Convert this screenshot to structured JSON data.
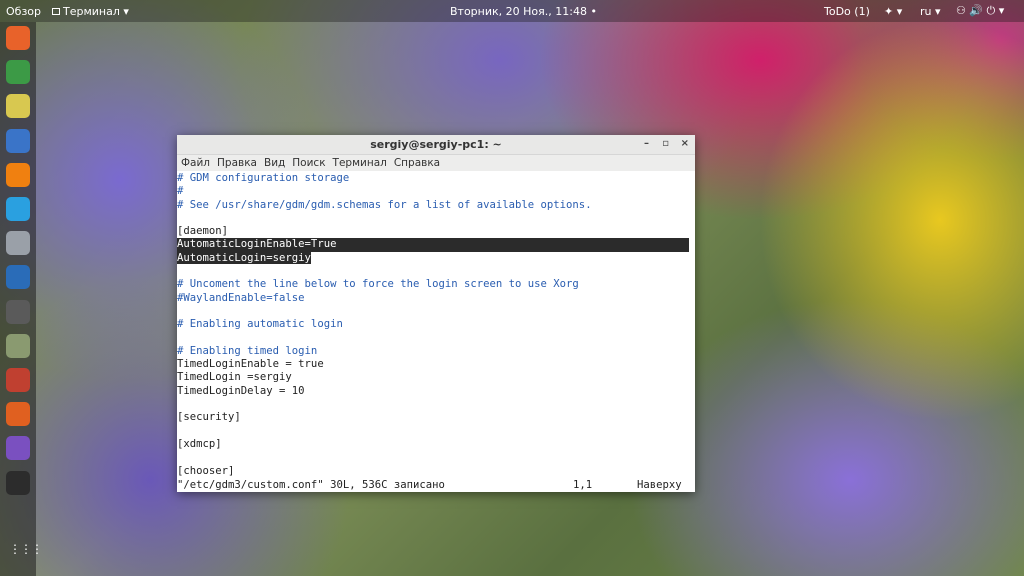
{
  "topbar": {
    "activities": "Обзор",
    "app_menu": "Терминал ▾",
    "clock": "Вторник, 20 Ноя., 11:48 •",
    "todo": "ToDo (1)",
    "accessibility": "✦ ▾",
    "lang": "ru ▾",
    "status_icons": "⚇ 🔊 ⏻ ▾"
  },
  "dock": {
    "items": [
      {
        "name": "firefox",
        "color": "#e8622a"
      },
      {
        "name": "chrome",
        "color": "#3c9a46"
      },
      {
        "name": "sound",
        "color": "#d8c850"
      },
      {
        "name": "notes",
        "color": "#3a74c8"
      },
      {
        "name": "vlc",
        "color": "#f08010"
      },
      {
        "name": "skype",
        "color": "#2aa0e0"
      },
      {
        "name": "tools",
        "color": "#9aa0a8"
      },
      {
        "name": "thunderbird",
        "color": "#2a6cb8"
      },
      {
        "name": "calculator",
        "color": "#5a5a5a"
      },
      {
        "name": "files",
        "color": "#8a9a70"
      },
      {
        "name": "downloader",
        "color": "#c04030"
      },
      {
        "name": "software",
        "color": "#e06020"
      },
      {
        "name": "viber",
        "color": "#7a50c0"
      },
      {
        "name": "terminal",
        "color": "#2c2c2c"
      }
    ],
    "apps_grid": "⋮⋮⋮"
  },
  "window": {
    "title": "sergiy@sergiy-pc1: ~",
    "minimize": "–",
    "maximize": "▫",
    "close": "×",
    "menu": [
      "Файл",
      "Правка",
      "Вид",
      "Поиск",
      "Терминал",
      "Справка"
    ],
    "lines": [
      {
        "t": "# GDM configuration storage",
        "k": "c"
      },
      {
        "t": "#",
        "k": "c"
      },
      {
        "t": "# See /usr/share/gdm/gdm.schemas for a list of available options.",
        "k": "c"
      },
      {
        "t": "",
        "k": ""
      },
      {
        "t": "[daemon]",
        "k": ""
      },
      {
        "t": "AutomaticLoginEnable=True",
        "k": "hlfull"
      },
      {
        "t": "AutomaticLogin=sergiy",
        "k": "hl"
      },
      {
        "t": "",
        "k": ""
      },
      {
        "t": "# Uncoment the line below to force the login screen to use Xorg",
        "k": "c"
      },
      {
        "t": "#WaylandEnable=false",
        "k": "c"
      },
      {
        "t": "",
        "k": ""
      },
      {
        "t": "# Enabling automatic login",
        "k": "c"
      },
      {
        "t": "",
        "k": ""
      },
      {
        "t": "# Enabling timed login",
        "k": "c"
      },
      {
        "t": "TimedLoginEnable = true",
        "k": ""
      },
      {
        "t": "TimedLogin =sergiy",
        "k": ""
      },
      {
        "t": "TimedLoginDelay = 10",
        "k": ""
      },
      {
        "t": "",
        "k": ""
      },
      {
        "t": "[security]",
        "k": ""
      },
      {
        "t": "",
        "k": ""
      },
      {
        "t": "[xdmcp]",
        "k": ""
      },
      {
        "t": "",
        "k": ""
      },
      {
        "t": "[chooser]",
        "k": ""
      }
    ],
    "status": {
      "file": "\"/etc/gdm3/custom.conf\" 30L, 536C записано",
      "pos": "1,1",
      "scroll": "Наверху"
    }
  }
}
